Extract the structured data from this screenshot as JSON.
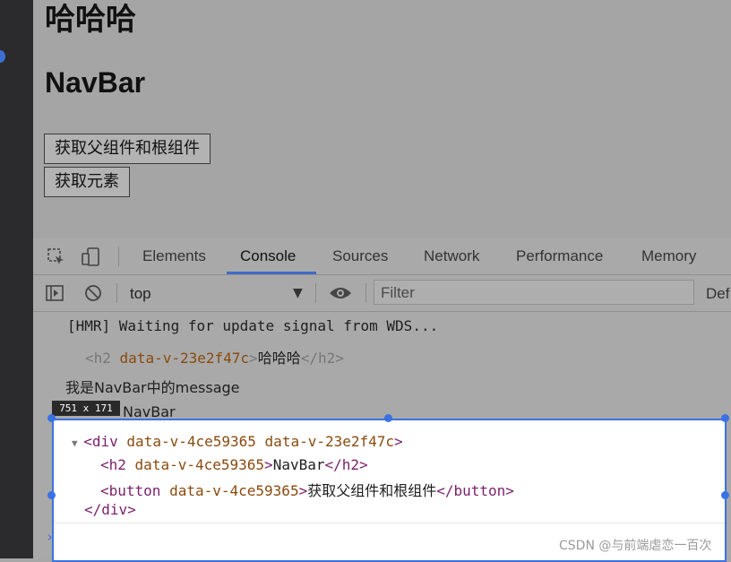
{
  "page": {
    "heading1": "哈哈哈",
    "heading2": "NavBar",
    "button_get_parent_root": "获取父组件和根组件",
    "button_get_element": "获取元素"
  },
  "devtools": {
    "tabs": [
      {
        "label": "Elements",
        "active": false
      },
      {
        "label": "Console",
        "active": true
      },
      {
        "label": "Sources",
        "active": false
      },
      {
        "label": "Network",
        "active": false
      },
      {
        "label": "Performance",
        "active": false
      },
      {
        "label": "Memory",
        "active": false
      }
    ],
    "toolbar": {
      "context": "top",
      "filter_placeholder": "Filter",
      "levels_label": "Def"
    },
    "console": {
      "hmr_line": "[HMR] Waiting for update signal from WDS...",
      "h2_line": {
        "open_tag": "<h2",
        "attr": "data-v-23e2f47c",
        "close_open": ">",
        "text": "哈哈哈",
        "end_tag": "</h2>"
      },
      "message_line": "我是NavBar中的message",
      "navbar_line": "NavBar",
      "size_badge": "751 x 171",
      "div_block": {
        "div_open": "<div",
        "div_attrs": "data-v-4ce59365 data-v-23e2f47c",
        "div_close": ">",
        "h2_open": "<h2",
        "h2_attr": "data-v-4ce59365",
        "h2_text": "NavBar",
        "h2_end": "</h2>",
        "button_open": "<button",
        "button_attr": "data-v-4ce59365",
        "button_text": "获取父组件和根组件",
        "button_end": "</button>",
        "div_end": "</div>"
      }
    }
  },
  "watermark": "CSDN @与前端虐恋一百次",
  "colors": {
    "accent": "#3b72e3",
    "tag": "#7a1f6b",
    "attr": "#8a4a0e"
  }
}
